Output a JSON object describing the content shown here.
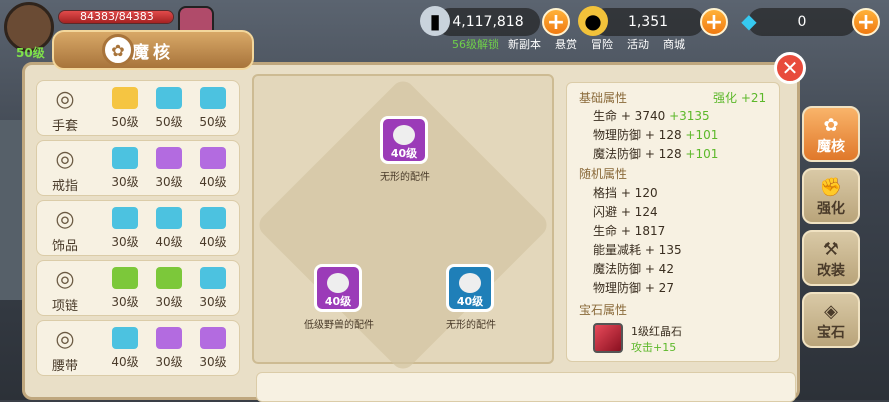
{
  "hud": {
    "hp": "84383/84383",
    "hp_fraction": 1.0,
    "player_level": "50级",
    "silver": "4,117,818",
    "gold": "1,351",
    "diamond": "0",
    "unlock_text": "56级解锁",
    "menu": [
      "新副本",
      "悬赏",
      "冒险",
      "活动",
      "商城"
    ]
  },
  "panel": {
    "title": "魔核",
    "close_icon": "close-icon"
  },
  "slots": [
    {
      "name": "手套",
      "icon": "glove-icon",
      "gems": [
        {
          "color": "#f5c542",
          "level": "50级"
        },
        {
          "color": "#4cc2e0",
          "level": "50级"
        },
        {
          "color": "#4cc2e0",
          "level": "50级"
        }
      ]
    },
    {
      "name": "戒指",
      "icon": "ring-icon",
      "gems": [
        {
          "color": "#4cc2e0",
          "level": "30级"
        },
        {
          "color": "#b36be0",
          "level": "30级"
        },
        {
          "color": "#b36be0",
          "level": "40级"
        }
      ]
    },
    {
      "name": "饰品",
      "icon": "earring-icon",
      "gems": [
        {
          "color": "#4cc2e0",
          "level": "30级"
        },
        {
          "color": "#4cc2e0",
          "level": "40级"
        },
        {
          "color": "#4cc2e0",
          "level": "40级"
        }
      ]
    },
    {
      "name": "项链",
      "icon": "necklace-icon",
      "gems": [
        {
          "color": "#7cc83a",
          "level": "30级"
        },
        {
          "color": "#7cc83a",
          "level": "30级"
        },
        {
          "color": "#4cc2e0",
          "level": "30级"
        }
      ]
    },
    {
      "name": "腰带",
      "icon": "belt-icon",
      "gems": [
        {
          "color": "#4cc2e0",
          "level": "40级"
        },
        {
          "color": "#b36be0",
          "level": "30级"
        },
        {
          "color": "#b36be0",
          "level": "30级"
        }
      ]
    }
  ],
  "equip": {
    "socket_top": {
      "level": "40级",
      "label": "无形的配件",
      "color": "#9b3bb8"
    },
    "socket_left": {
      "level": "40级",
      "label": "低级野兽的配件",
      "color": "#9b3bb8"
    },
    "socket_right": {
      "level": "40级",
      "label": "无形的配件",
      "color": "#1f7fb8"
    }
  },
  "stats": {
    "base_title": "基础属性",
    "enhance": "强化 +21",
    "base": [
      {
        "label": "生命 + 3740",
        "bonus": "+3135"
      },
      {
        "label": "物理防御 + 128",
        "bonus": "+101"
      },
      {
        "label": "魔法防御 + 128",
        "bonus": "+101"
      }
    ],
    "random_title": "随机属性",
    "random": [
      "格挡 + 120",
      "闪避 + 124",
      "生命 + 1817",
      "能量减耗 + 135",
      "魔法防御 + 42",
      "物理防御 + 27"
    ],
    "gem_title": "宝石属性",
    "gem_name": "1级红晶石",
    "gem_bonus": "攻击+15"
  },
  "tabs": [
    "魔核",
    "强化",
    "改装",
    "宝石"
  ]
}
